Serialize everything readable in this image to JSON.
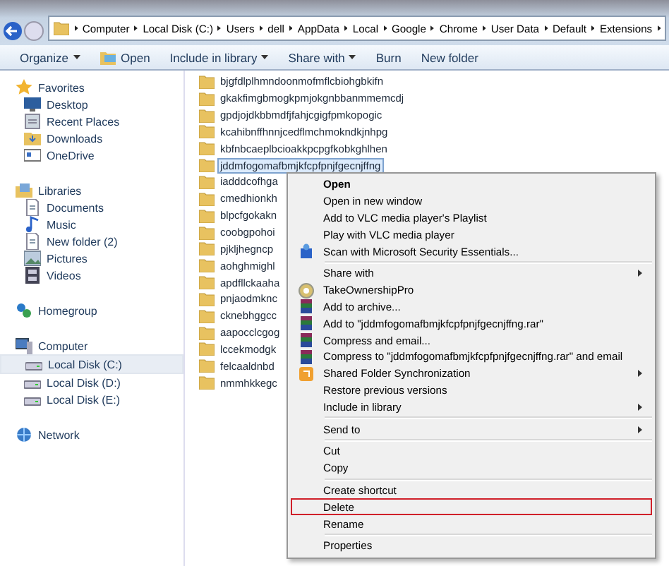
{
  "address_bar": {
    "crumbs": [
      "Computer",
      "Local Disk (C:)",
      "Users",
      "dell",
      "AppData",
      "Local",
      "Google",
      "Chrome",
      "User Data",
      "Default",
      "Extensions"
    ]
  },
  "toolbar": [
    {
      "label": "Organize",
      "dropdown": true
    },
    {
      "label": "Open",
      "dropdown": false
    },
    {
      "label": "Include in library",
      "dropdown": true
    },
    {
      "label": "Share with",
      "dropdown": true
    },
    {
      "label": "Burn",
      "dropdown": false
    },
    {
      "label": "New folder",
      "dropdown": false
    }
  ],
  "sidebar": {
    "sections": [
      {
        "label": "Favorites",
        "items": [
          {
            "label": "Desktop",
            "selected": false
          },
          {
            "label": "Recent Places",
            "selected": false
          },
          {
            "label": "Downloads",
            "selected": false
          },
          {
            "label": "OneDrive",
            "selected": false
          }
        ]
      },
      {
        "label": "Libraries",
        "items": [
          {
            "label": "Documents",
            "selected": false
          },
          {
            "label": "Music",
            "selected": false
          },
          {
            "label": "New folder (2)",
            "selected": false
          },
          {
            "label": "Pictures",
            "selected": false
          },
          {
            "label": "Videos",
            "selected": false
          }
        ]
      },
      {
        "label": "Homegroup"
      },
      {
        "label": "Computer",
        "items": [
          {
            "label": "Local Disk (C:)",
            "selected": true
          },
          {
            "label": "Local Disk (D:)",
            "selected": false
          },
          {
            "label": "Local Disk (E:)",
            "selected": false
          }
        ]
      },
      {
        "label": "Network"
      }
    ]
  },
  "files": [
    {
      "name": "bjgfdlplhmndoonmofmflcbiohgbkifn",
      "selected": false
    },
    {
      "name": "gkakfimgbmogkpmjokgnbbanmmemcdj",
      "selected": false
    },
    {
      "name": "gpdjojdkbbmdfjfahjcgigfpmkopogic",
      "selected": false
    },
    {
      "name": "kcahibnffhnnjcedflmchmokndkjnhpg",
      "selected": false
    },
    {
      "name": "kbfnbcaeplbcioakkpcpgfkobkghlhen",
      "selected": false
    },
    {
      "name": "jddmfogomafbmjkfcpfpnjfgecnjffng",
      "selected": true
    },
    {
      "name": "iadddcofhga",
      "selected": false
    },
    {
      "name": "cmedhionkh",
      "selected": false
    },
    {
      "name": "blpcfgokakn",
      "selected": false
    },
    {
      "name": "coobgpohoi",
      "selected": false
    },
    {
      "name": "pjkljhegncp",
      "selected": false
    },
    {
      "name": "aohghmighl",
      "selected": false
    },
    {
      "name": "apdfllckaaha",
      "selected": false
    },
    {
      "name": "pnjaodmknc",
      "selected": false
    },
    {
      "name": "cknebhggcc",
      "selected": false
    },
    {
      "name": "aapocclcgog",
      "selected": false
    },
    {
      "name": "lccekmodgk",
      "selected": false
    },
    {
      "name": "felcaaldnbd",
      "selected": false
    },
    {
      "name": "nmmhkkegc",
      "selected": false
    }
  ],
  "context_menu": [
    {
      "kind": "item",
      "label": "Open",
      "bold": true,
      "submenu": false,
      "highlighted": false
    },
    {
      "kind": "item",
      "label": "Open in new window",
      "bold": false,
      "submenu": false,
      "highlighted": false
    },
    {
      "kind": "item",
      "label": "Add to VLC media player's Playlist",
      "bold": false,
      "submenu": false,
      "highlighted": false
    },
    {
      "kind": "item",
      "label": "Play with VLC media player",
      "bold": false,
      "submenu": false,
      "highlighted": false
    },
    {
      "kind": "item",
      "label": "Scan with Microsoft Security Essentials...",
      "bold": false,
      "submenu": false,
      "highlighted": false
    },
    {
      "kind": "separator"
    },
    {
      "kind": "item",
      "label": "Share with",
      "bold": false,
      "submenu": true,
      "highlighted": false
    },
    {
      "kind": "item",
      "label": "TakeOwnershipPro",
      "bold": false,
      "submenu": false,
      "highlighted": false
    },
    {
      "kind": "item",
      "label": "Add to archive...",
      "bold": false,
      "submenu": false,
      "highlighted": false
    },
    {
      "kind": "item",
      "label": "Add to \"jddmfogomafbmjkfcpfpnjfgecnjffng.rar\"",
      "bold": false,
      "submenu": false,
      "highlighted": false
    },
    {
      "kind": "item",
      "label": "Compress and email...",
      "bold": false,
      "submenu": false,
      "highlighted": false
    },
    {
      "kind": "item",
      "label": "Compress to \"jddmfogomafbmjkfcpfpnjfgecnjffng.rar\" and email",
      "bold": false,
      "submenu": false,
      "highlighted": false
    },
    {
      "kind": "item",
      "label": "Shared Folder Synchronization",
      "bold": false,
      "submenu": true,
      "highlighted": false
    },
    {
      "kind": "item",
      "label": "Restore previous versions",
      "bold": false,
      "submenu": false,
      "highlighted": false
    },
    {
      "kind": "item",
      "label": "Include in library",
      "bold": false,
      "submenu": true,
      "highlighted": false
    },
    {
      "kind": "separator"
    },
    {
      "kind": "item",
      "label": "Send to",
      "bold": false,
      "submenu": true,
      "highlighted": false
    },
    {
      "kind": "separator"
    },
    {
      "kind": "item",
      "label": "Cut",
      "bold": false,
      "submenu": false,
      "highlighted": false
    },
    {
      "kind": "item",
      "label": "Copy",
      "bold": false,
      "submenu": false,
      "highlighted": false
    },
    {
      "kind": "separator"
    },
    {
      "kind": "item",
      "label": "Create shortcut",
      "bold": false,
      "submenu": false,
      "highlighted": false
    },
    {
      "kind": "item",
      "label": "Delete",
      "bold": false,
      "submenu": false,
      "highlighted": true
    },
    {
      "kind": "item",
      "label": "Rename",
      "bold": false,
      "submenu": false,
      "highlighted": false
    },
    {
      "kind": "separator"
    },
    {
      "kind": "item",
      "label": "Properties",
      "bold": false,
      "submenu": false,
      "highlighted": false
    }
  ]
}
